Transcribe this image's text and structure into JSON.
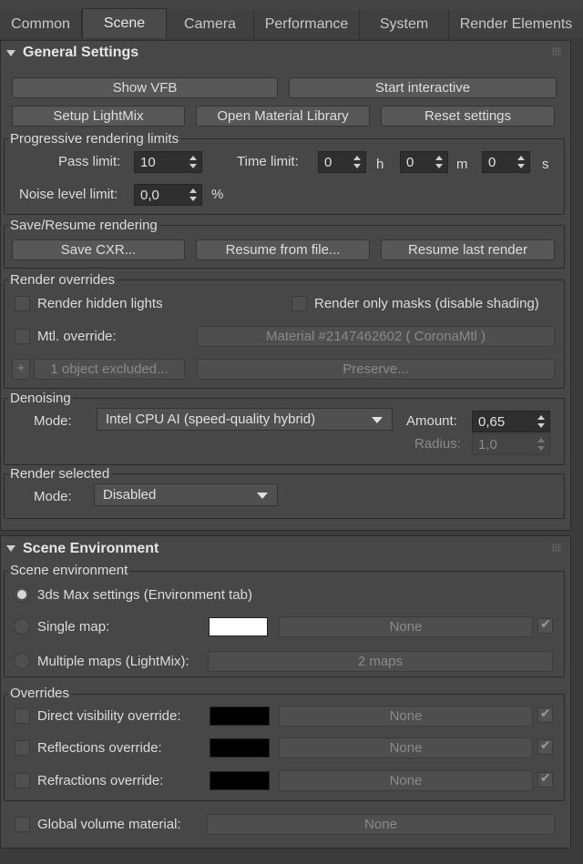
{
  "tabs": [
    "Common",
    "Scene",
    "Camera",
    "Performance",
    "System",
    "Render Elements"
  ],
  "active_tab": "Scene",
  "general": {
    "title": "General Settings",
    "show_vfb": "Show VFB",
    "start_interactive": "Start interactive",
    "setup_lightmix": "Setup LightMix",
    "open_material_library": "Open Material Library",
    "reset_settings": "Reset settings"
  },
  "progressive": {
    "title": "Progressive rendering limits",
    "pass_limit_label": "Pass limit:",
    "pass_limit": "10",
    "time_limit_label": "Time limit:",
    "hours": "0",
    "h": "h",
    "minutes": "0",
    "m": "m",
    "seconds": "0",
    "s": "s",
    "noise_label": "Noise level limit:",
    "noise": "0,0",
    "percent": "%"
  },
  "save_resume": {
    "title": "Save/Resume rendering",
    "save_cxr": "Save CXR...",
    "resume_file": "Resume from file...",
    "resume_last": "Resume last render"
  },
  "overrides_render": {
    "title": "Render overrides",
    "hidden_lights": "Render hidden lights",
    "only_masks": "Render only masks (disable shading)",
    "mtl_override": "Mtl. override:",
    "material": "Material #2147462602  ( CoronaMtl )",
    "plus": "+",
    "excluded": "1 object excluded...",
    "preserve": "Preserve..."
  },
  "denoising": {
    "title": "Denoising",
    "mode_label": "Mode:",
    "mode": "Intel CPU AI (speed-quality hybrid)",
    "amount_label": "Amount:",
    "amount": "0,65",
    "radius_label": "Radius:",
    "radius": "1,0"
  },
  "render_selected": {
    "title": "Render selected",
    "mode_label": "Mode:",
    "mode": "Disabled"
  },
  "scene_env": {
    "title": "Scene Environment",
    "group_title": "Scene environment",
    "max_settings": "3ds Max settings (Environment tab)",
    "single_map": "Single map:",
    "single_map_btn": "None",
    "single_map_color": "#ffffff",
    "multiple_maps": "Multiple maps (LightMix):",
    "multiple_maps_btn": "2 maps"
  },
  "overrides_env": {
    "title": "Overrides",
    "direct": "Direct visibility override:",
    "reflections": "Reflections override:",
    "refractions": "Refractions override:",
    "none": "None",
    "color": "#000000"
  },
  "global_volume": {
    "label": "Global volume material:",
    "btn": "None"
  }
}
